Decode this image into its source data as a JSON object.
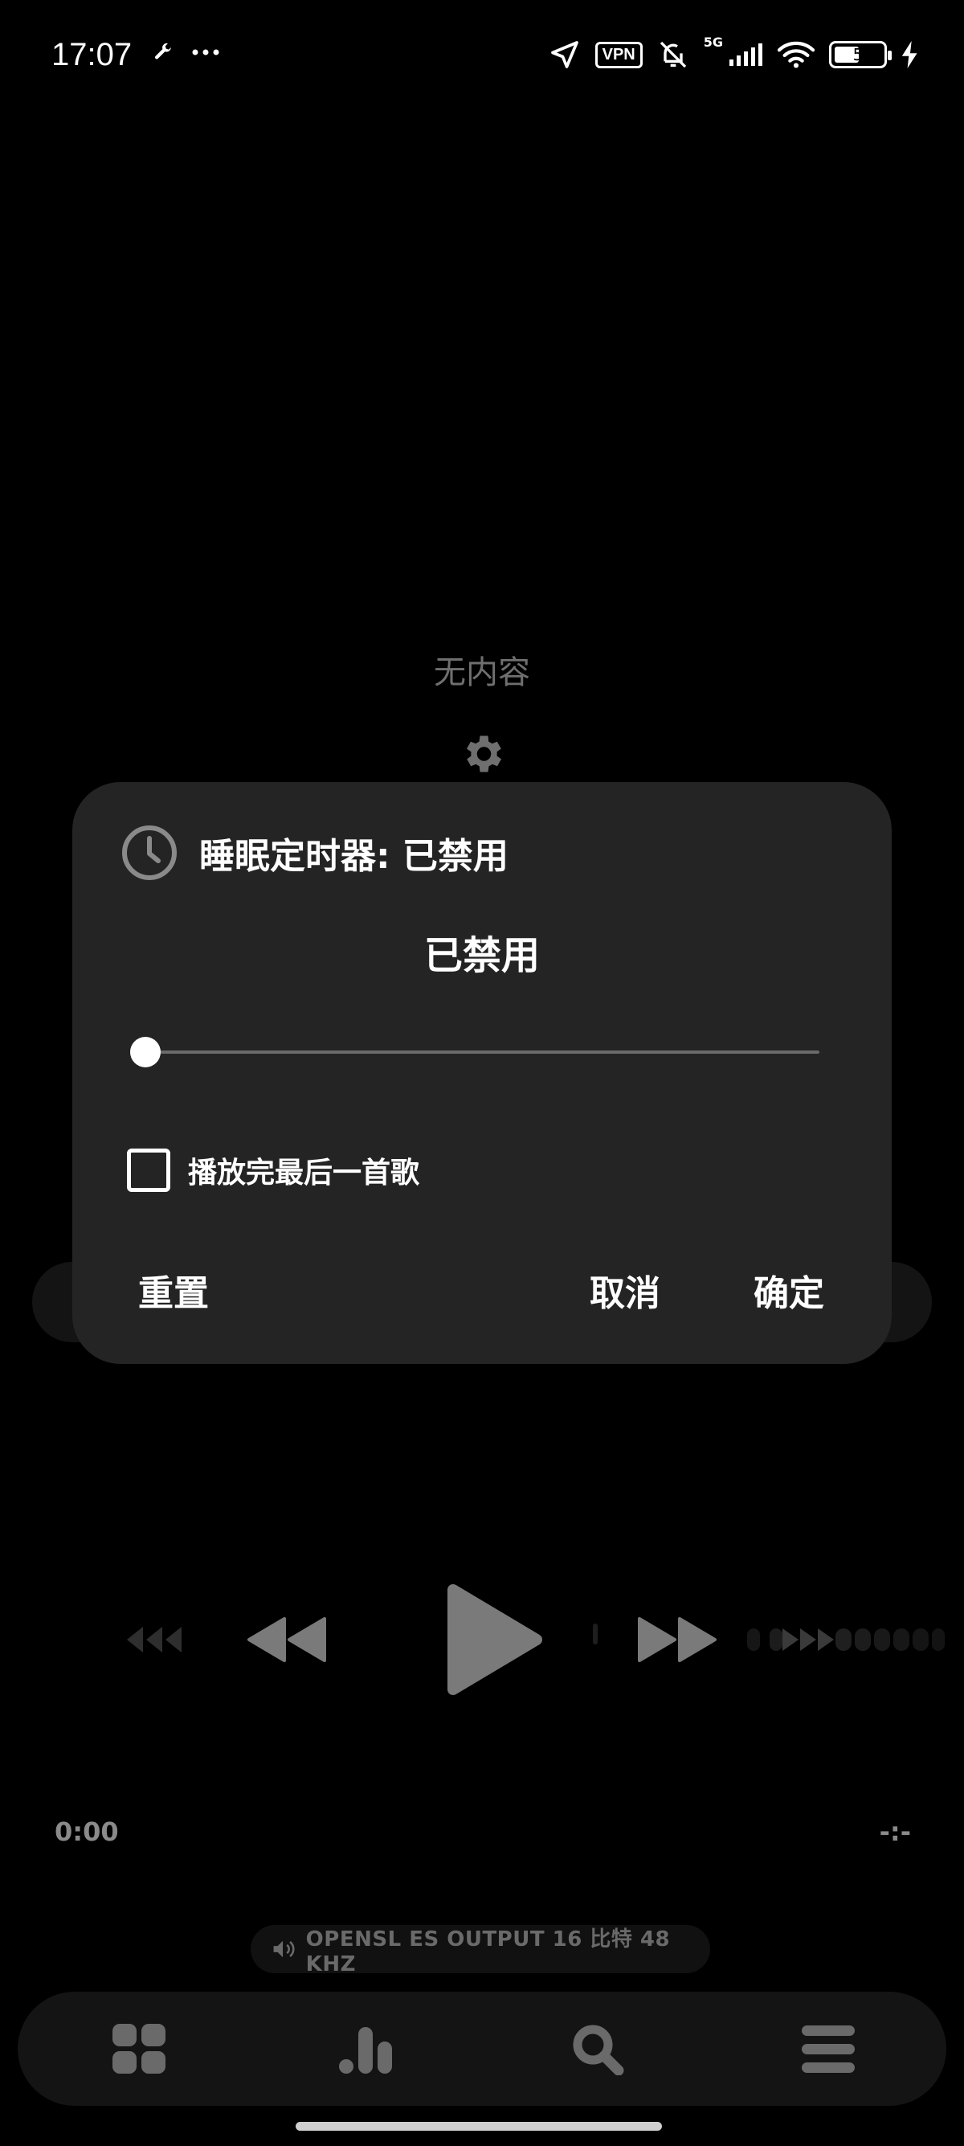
{
  "status_bar": {
    "time": "17:07",
    "vpn": "VPN",
    "network": "5G",
    "battery": "5"
  },
  "main": {
    "empty_text": "无内容"
  },
  "dialog": {
    "title": "睡眠定时器: 已禁用",
    "value_text": "已禁用",
    "slider_value": 0,
    "checkbox_label": "播放完最后一首歌",
    "checkbox_checked": false,
    "reset_label": "重置",
    "cancel_label": "取消",
    "ok_label": "确定"
  },
  "player": {
    "time_current": "0:00",
    "time_total": "-:-",
    "output_info": "OPENSL ES OUTPUT  16 比特  48 KHZ"
  },
  "colors": {
    "background": "#000000",
    "dialog": "#242424",
    "muted": "#6f6f6f"
  }
}
